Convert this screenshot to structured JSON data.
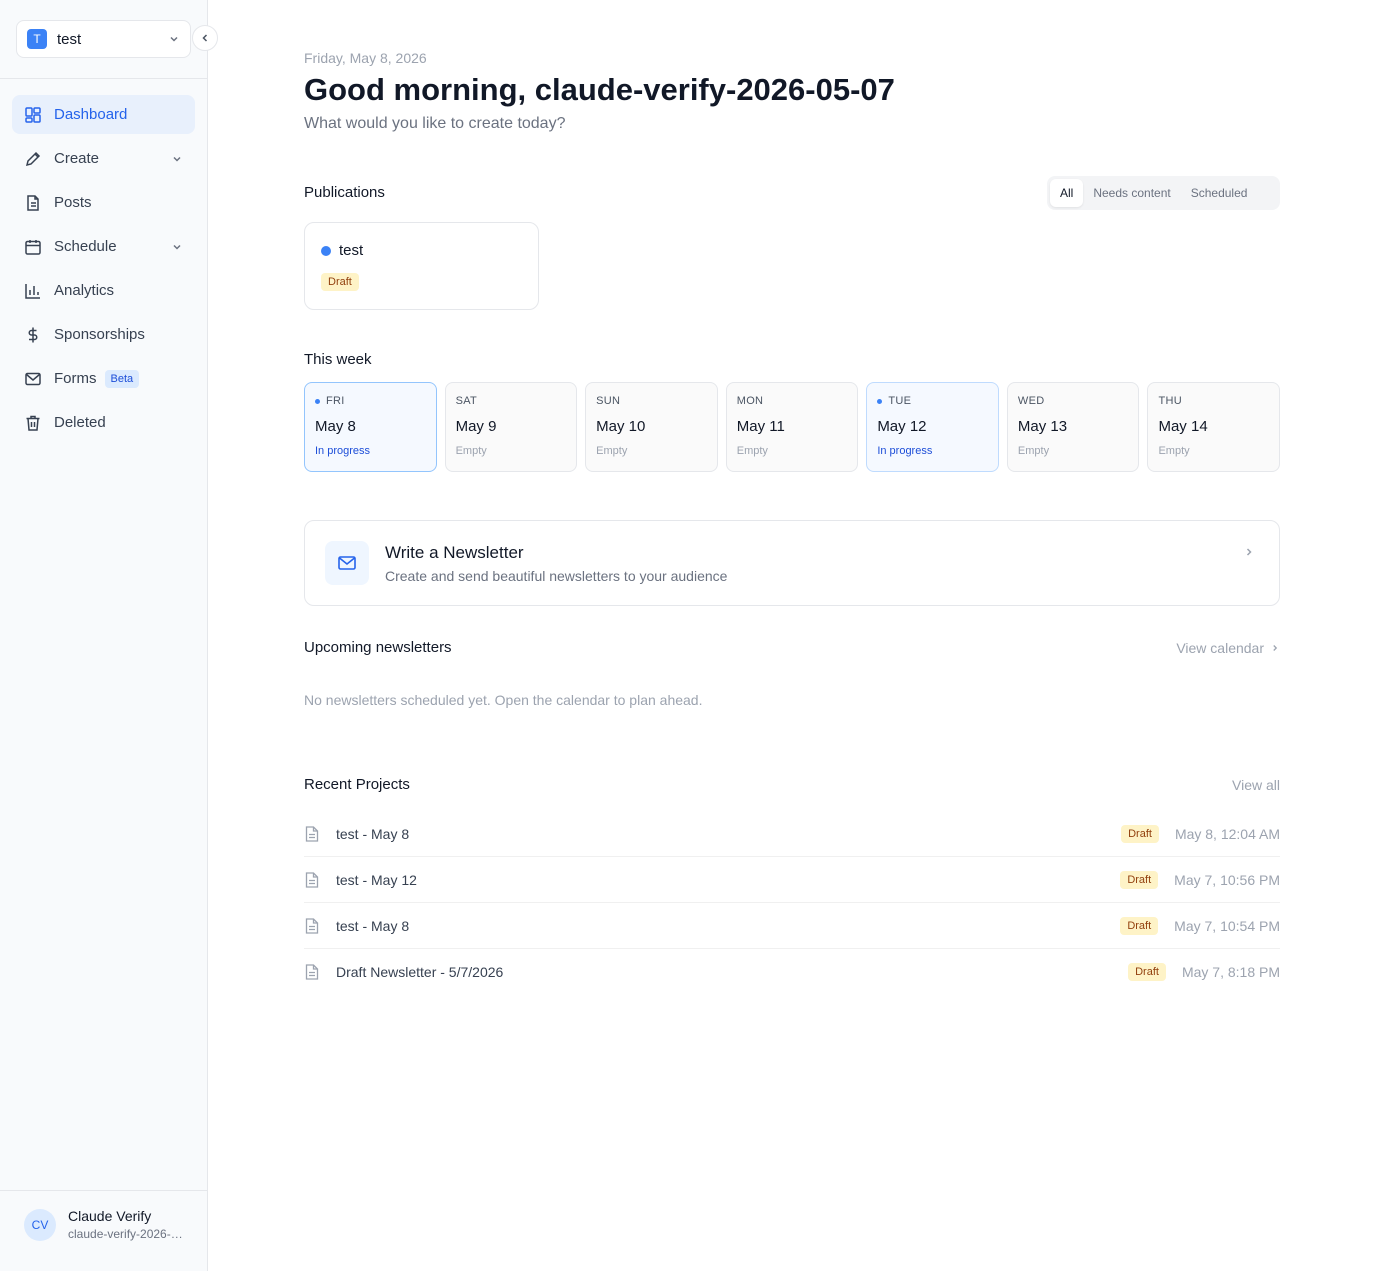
{
  "workspace": {
    "badge": "T",
    "name": "test"
  },
  "nav": {
    "items": [
      {
        "label": "Dashboard"
      },
      {
        "label": "Create"
      },
      {
        "label": "Posts"
      },
      {
        "label": "Schedule"
      },
      {
        "label": "Analytics"
      },
      {
        "label": "Sponsorships"
      },
      {
        "label": "Forms",
        "badge": "Beta"
      },
      {
        "label": "Deleted"
      }
    ]
  },
  "user": {
    "initials": "CV",
    "name": "Claude Verify",
    "email": "claude-verify-2026-05-07"
  },
  "header": {
    "date": "Friday, May 8, 2026",
    "greeting": "Good morning, claude-verify-2026-05-07",
    "subtitle": "What would you like to create today?"
  },
  "publications": {
    "title": "Publications",
    "filters": [
      "All",
      "Needs content",
      "Scheduled"
    ],
    "active_filter": "All",
    "cards": [
      {
        "name": "test",
        "status": "Draft"
      }
    ]
  },
  "week": {
    "title": "This week",
    "days": [
      {
        "dow": "FRI",
        "date": "May 8",
        "status": "In progress"
      },
      {
        "dow": "SAT",
        "date": "May 9",
        "status": "Empty"
      },
      {
        "dow": "SUN",
        "date": "May 10",
        "status": "Empty"
      },
      {
        "dow": "MON",
        "date": "May 11",
        "status": "Empty"
      },
      {
        "dow": "TUE",
        "date": "May 12",
        "status": "In progress"
      },
      {
        "dow": "WED",
        "date": "May 13",
        "status": "Empty"
      },
      {
        "dow": "THU",
        "date": "May 14",
        "status": "Empty"
      }
    ]
  },
  "cta": {
    "title": "Write a Newsletter",
    "description": "Create and send beautiful newsletters to your audience"
  },
  "upcoming": {
    "title": "Upcoming newsletters",
    "link": "View calendar",
    "empty": "No newsletters scheduled yet. Open the calendar to plan ahead."
  },
  "recent": {
    "title": "Recent Projects",
    "link": "View all",
    "items": [
      {
        "name": "test - May 8",
        "status": "Draft",
        "time": "May 8, 12:04 AM"
      },
      {
        "name": "test - May 12",
        "status": "Draft",
        "time": "May 7, 10:56 PM"
      },
      {
        "name": "test - May 8",
        "status": "Draft",
        "time": "May 7, 10:54 PM"
      },
      {
        "name": "Draft Newsletter - 5/7/2026",
        "status": "Draft",
        "time": "May 7, 8:18 PM"
      }
    ]
  },
  "colors": {
    "accent": "#2563eb",
    "draft_bg": "#fef3c7",
    "draft_fg": "#92400e"
  }
}
